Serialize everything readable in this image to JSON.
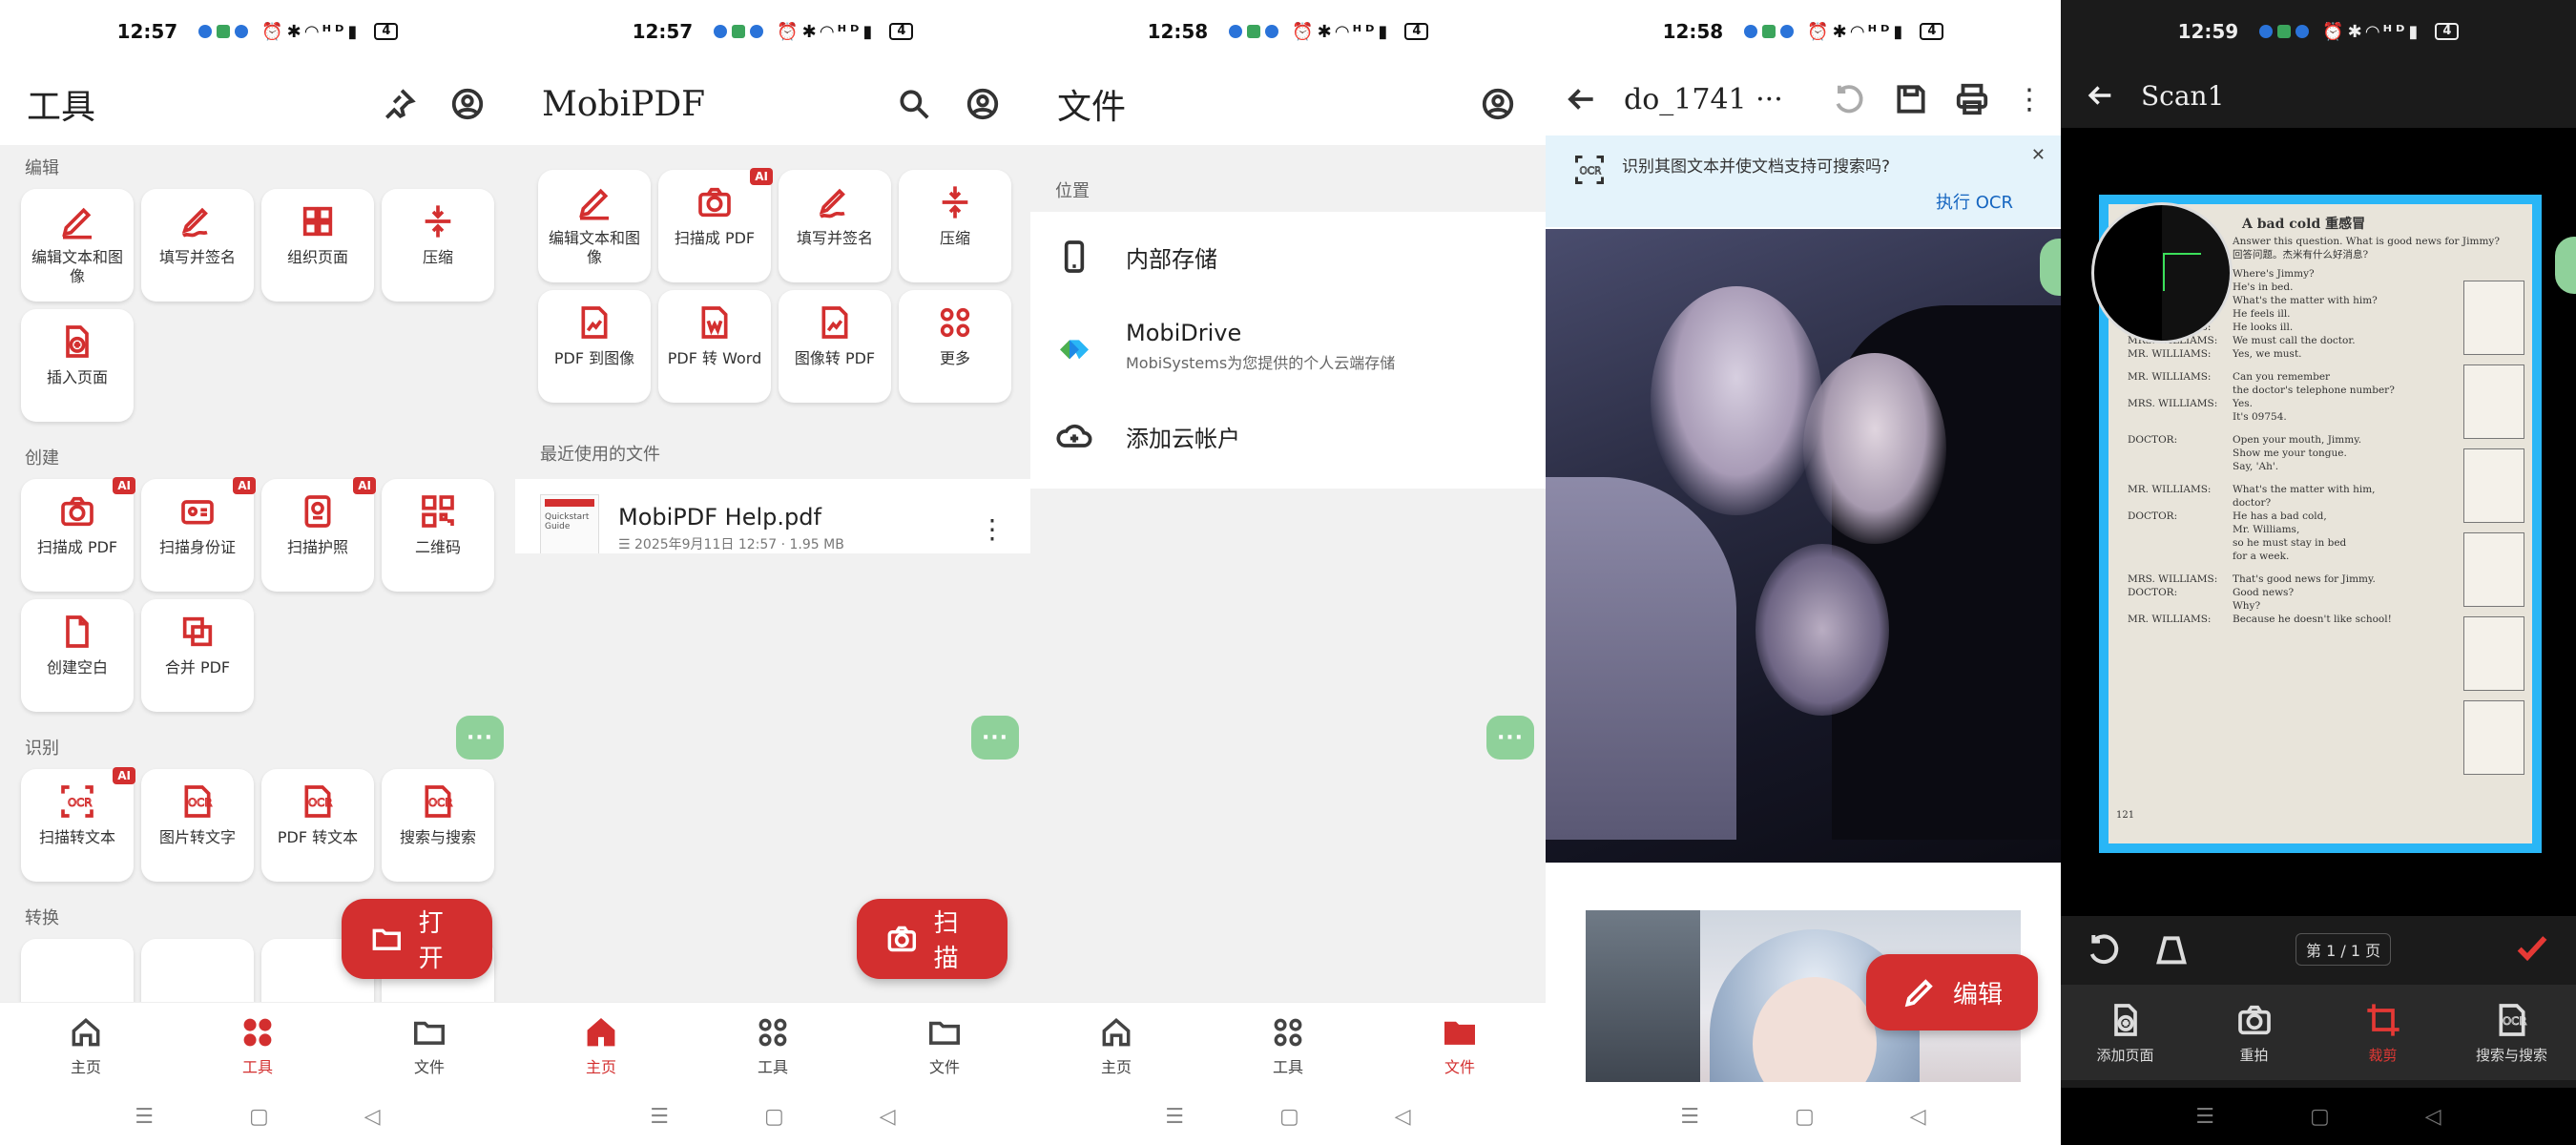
{
  "status": [
    {
      "time": "12:57",
      "battery": "4"
    },
    {
      "time": "12:57",
      "battery": "4"
    },
    {
      "time": "12:58",
      "battery": "4"
    },
    {
      "time": "12:58",
      "battery": "4"
    },
    {
      "time": "12:59",
      "battery": "4"
    }
  ],
  "colors": {
    "accent": "#d32f2f",
    "scan_frame": "#29b6f6",
    "mini_fab": "#8fd19a",
    "banner_bg": "#e4f3fb"
  },
  "p1": {
    "title": "工具",
    "sections": {
      "edit": "编辑",
      "create": "创建",
      "recognize": "识别",
      "convert": "转换"
    },
    "edit_tiles": [
      "编辑文本和图像",
      "填写并签名",
      "组织页面",
      "压缩",
      "插入页面"
    ],
    "create_tiles": [
      "扫描成 PDF",
      "扫描身份证",
      "扫描护照",
      "二维码",
      "创建空白",
      "合并 PDF"
    ],
    "recognize_tiles": [
      "扫描转文本",
      "图片转文字",
      "PDF 转文本",
      "搜索与搜索"
    ],
    "ai_badge": "AI",
    "fab_label": "打开",
    "mini_fab": "···"
  },
  "p2": {
    "title": "MobiPDF",
    "tiles": [
      "编辑文本和图像",
      "扫描成 PDF",
      "填写并签名",
      "压缩",
      "PDF 到图像",
      "PDF 转 Word",
      "图像转 PDF",
      "更多"
    ],
    "recent_label": "最近使用的文件",
    "file": {
      "name": "MobiPDF Help.pdf",
      "meta": "2025年9月11日 12:57 · 1.95 MB",
      "thumb_title": "Quickstart Guide"
    },
    "fab_label": "扫描"
  },
  "p3": {
    "title": "文件",
    "locations_label": "位置",
    "rows": [
      {
        "title": "内部存储",
        "sub": ""
      },
      {
        "title": "MobiDrive",
        "sub": "MobiSystems为您提供的个人云端存储"
      },
      {
        "title": "添加云帐户",
        "sub": ""
      }
    ]
  },
  "p4": {
    "title": "do_1741 ···",
    "banner_text": "识别其图文本并使文档支持可搜索吗?",
    "banner_action": "执行 OCR",
    "banner_badge": "OCR",
    "fab_label": "编辑"
  },
  "p5": {
    "title": "Scan1",
    "page_counter": "第 1 / 1 页",
    "actions": [
      "添加页面",
      "重拍",
      "裁剪",
      "搜索与搜索"
    ],
    "page": {
      "heading": "A bad cold  重感冒",
      "q": "Answer this question. What is good news for Jimmy?",
      "q2": "回答问题。杰米有什么好消息?",
      "lines": [
        [
          "",
          "Where's Jimmy?"
        ],
        [
          "",
          "He's in bed."
        ],
        [
          "",
          "What's the matter with him?"
        ],
        [
          "",
          "He feels ill."
        ],
        [
          "MR. WILLIAMS:",
          "He looks ill."
        ],
        [
          "MRS. WILLIAMS:",
          "We must call the doctor."
        ],
        [
          "MR. WILLIAMS:",
          "Yes, we must."
        ],
        [
          "MR. WILLIAMS:",
          "Can you remember"
        ],
        [
          "",
          "the doctor's telephone number?"
        ],
        [
          "MRS. WILLIAMS:",
          "Yes."
        ],
        [
          "",
          "It's 09754."
        ],
        [
          "DOCTOR:",
          "Open your mouth, Jimmy."
        ],
        [
          "",
          "Show me your tongue."
        ],
        [
          "",
          "Say, 'Ah'."
        ],
        [
          "MR. WILLIAMS:",
          "What's the matter with him,"
        ],
        [
          "",
          "doctor?"
        ],
        [
          "DOCTOR:",
          "He has a bad cold,"
        ],
        [
          "",
          "Mr. Williams,"
        ],
        [
          "",
          "so he must stay in bed"
        ],
        [
          "",
          "for a week."
        ],
        [
          "MRS. WILLIAMS:",
          "That's good news for Jimmy."
        ],
        [
          "DOCTOR:",
          "Good news?"
        ],
        [
          "",
          "Why?"
        ],
        [
          "MR. WILLIAMS:",
          "Because he doesn't like school!"
        ]
      ],
      "page_number": "121"
    }
  },
  "nav": {
    "home": "主页",
    "tools": "工具",
    "files": "文件"
  }
}
